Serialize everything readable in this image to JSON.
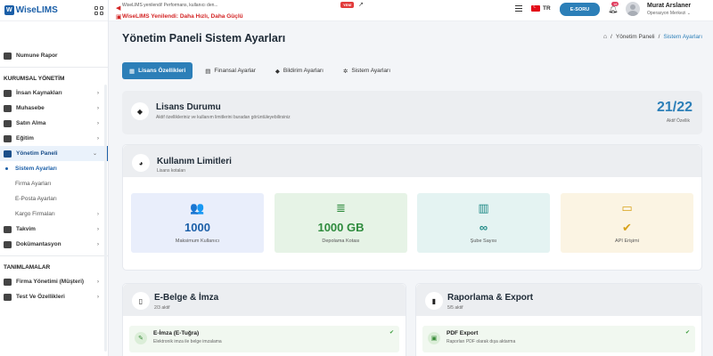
{
  "brand": {
    "logo_mark": "W",
    "name": "WiseLIMS"
  },
  "sidebar": {
    "top_item": "Numune Rapor",
    "section1": "KURUMSAL YÖNETİM",
    "items": [
      {
        "label": "İnsan Kaynakları",
        "chev": "›"
      },
      {
        "label": "Muhasebe",
        "chev": "›"
      },
      {
        "label": "Satın Alma",
        "chev": "›"
      },
      {
        "label": "Eğitim",
        "chev": "›"
      },
      {
        "label": "Yönetim Paneli",
        "chev": "⌄"
      }
    ],
    "sub_items": [
      "Sistem Ayarları",
      "Firma Ayarları",
      "E-Posta Ayarları",
      "Kargo Firmaları"
    ],
    "sub_chev": "›",
    "after_items": [
      {
        "label": "Takvim",
        "chev": "›"
      },
      {
        "label": "Dokümantasyon",
        "chev": "›"
      }
    ],
    "section2": "TANIMLAMALAR",
    "def_items": [
      {
        "label": "Firma Yönetimi (Müşteri)",
        "chev": "›"
      },
      {
        "label": "Test Ve Özellikleri",
        "chev": "›"
      }
    ]
  },
  "topbar": {
    "announce_line1": "WiseLIMS yenilendi! Performans, kullanıcı den...",
    "announce_line2": "WiseLIMS Yenilendi: Daha Hızlı, Daha Güçlü",
    "badge": "YENİ",
    "lang": "TR",
    "esoru": "E-SORU",
    "notif_count": "18",
    "user_name": "Murat Arslaner",
    "user_org": "Operasyon Merkezi ⌄"
  },
  "page": {
    "title": "Yönetim Paneli Sistem Ayarları",
    "breadcrumb": [
      "Yönetim Paneli",
      "Sistem Ayarları"
    ],
    "sep": "/"
  },
  "tabs": [
    {
      "label": "Lisans Özellikleri",
      "icon": "▦"
    },
    {
      "label": "Finansal Ayarlar",
      "icon": "▤"
    },
    {
      "label": "Bildirim Ayarları",
      "icon": "◆"
    },
    {
      "label": "Sistem Ayarları",
      "icon": "✲"
    }
  ],
  "license": {
    "title": "Lisans Durumu",
    "subtitle": "Aktif özellikleriniz ve kullanım limitlerini buradan görüntüleyebilirsiniz",
    "count": "21/22",
    "count_label": "Aktif Özellik"
  },
  "usage": {
    "title": "Kullanım Limitleri",
    "subtitle": "Lisans kotaları",
    "tiles": [
      {
        "value": "1000",
        "label": "Maksimum Kullanıcı",
        "icon": "👥",
        "bg": "#e9eefb",
        "fg": "#2c67c7"
      },
      {
        "value": "1000 GB",
        "label": "Depolama Kotası",
        "icon": "≣",
        "bg": "#e6f3e6",
        "fg": "#2e8b3d"
      },
      {
        "value": "∞",
        "label": "Şube Sayısı",
        "icon": "▥",
        "bg": "#e4f3f2",
        "fg": "#1f8a86"
      },
      {
        "value": "✔",
        "label": "API Erişimi",
        "icon": "▭",
        "bg": "#fbf4e3",
        "fg": "#d8a21a"
      }
    ]
  },
  "ebelge": {
    "title": "E-Belge & İmza",
    "subtitle": "2/3 aktif",
    "feature_title": "E-İmza (E-Tuğra)",
    "feature_sub": "Elektronik imza ile belge imzalama",
    "icon": "✎"
  },
  "rapor": {
    "title": "Raporlama & Export",
    "subtitle": "5/5 aktif",
    "feature_title": "PDF Export",
    "feature_sub": "Raporları PDF olarak dışa aktarma",
    "icon": "▣"
  }
}
